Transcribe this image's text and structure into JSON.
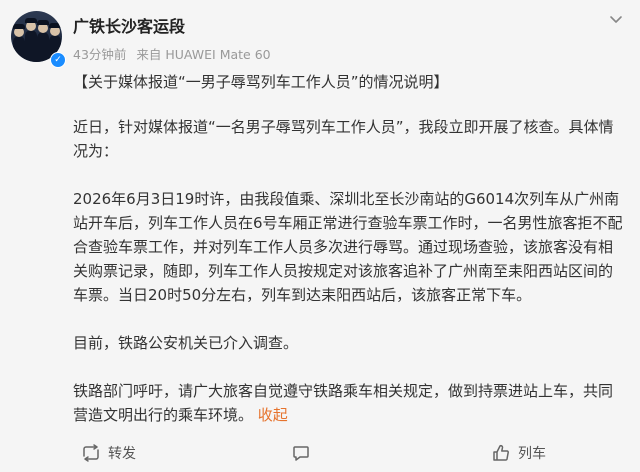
{
  "account": {
    "name": "广铁长沙客运段",
    "time": "43分钟前",
    "source": "来自 HUAWEI Mate 60"
  },
  "post": {
    "title": "【关于媒体报道“一男子辱骂列车工作人员”的情况说明】",
    "paragraphs": [
      "近日，针对媒体报道“一名男子辱骂列车工作人员”，我段立即开展了核查。具体情况为：",
      "2026年6月3日19时许，由我段值乘、深圳北至长沙南站的G6014次列车从广州南站开车后，列车工作人员在6号车厢正常进行查验车票工作时，一名男性旅客拒不配合查验车票工作，并对列车工作人员多次进行辱骂。通过现场查验，该旅客没有相关购票记录，随即，列车工作人员按规定对该旅客追补了广州南至耒阳西站区间的车票。当日20时50分左右，列车到达耒阳西站后，该旅客正常下车。",
      "目前，铁路公安机关已介入调查。",
      "铁路部门呼吁，请广大旅客自觉遵守铁路乘车相关规定，做到持票进站上车，共同营造文明出行的乘车环境。"
    ],
    "collapse_label": "收起"
  },
  "actions": {
    "repost_label": "转发",
    "like_label": "列车"
  },
  "colors": {
    "link": "#e6732d",
    "verified": "#1a8cff"
  },
  "icons": [
    "more-icon",
    "repost-icon",
    "comment-icon",
    "like-icon",
    "verified-icon"
  ]
}
